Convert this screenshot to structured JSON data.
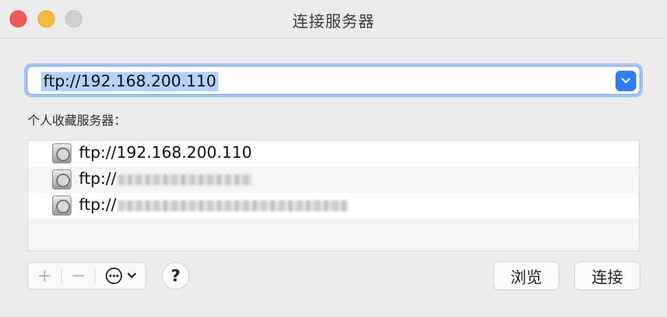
{
  "window": {
    "title": "连接服务器"
  },
  "server_address": {
    "value": "ftp://192.168.200.110"
  },
  "favorites": {
    "label": "个人收藏服务器：",
    "items": [
      {
        "prefix": "ftp://",
        "text": "192.168.200.110",
        "icon": "network-drive-icon"
      },
      {
        "prefix": "ftp://",
        "text": "",
        "icon": "network-drive-icon"
      },
      {
        "prefix": "ftp://",
        "text": "",
        "icon": "network-drive-icon"
      }
    ]
  },
  "toolbar": {
    "add_symbol": "+",
    "remove_symbol": "−",
    "help_symbol": "?"
  },
  "buttons": {
    "browse": "浏览",
    "connect": "连接"
  },
  "colors": {
    "accent": "#2f7cf6",
    "selection": "#b3d2fb",
    "close": "#ee5b56",
    "minimize": "#f4bc3d",
    "maximize": "#cfcfcf"
  }
}
